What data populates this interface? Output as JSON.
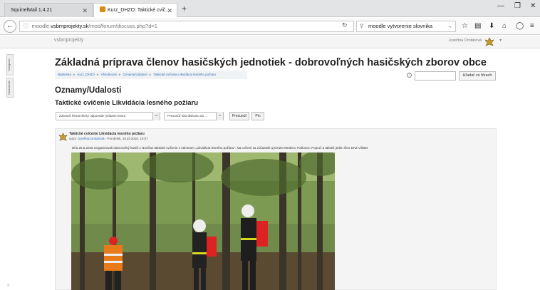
{
  "browser": {
    "tabs": [
      {
        "title": "SquirrelMail 1.4.21"
      },
      {
        "title": "Kurz_DHZO: Taktické cvič..."
      }
    ],
    "url_gray": "moodle.",
    "url_bold": "vsbmprojekty.sk",
    "url_rest": "/mod/forum/discuss.php?d=1",
    "search_value": "moodle vytvorenie slovnika"
  },
  "header": {
    "site_name": "vsbmprojekty",
    "user_name": "Jozefína Drotárová"
  },
  "blocks": {
    "navigation": "Navigácia",
    "admin": "Nastavenie"
  },
  "page": {
    "title": "Základná príprava členov hasičských jednotiek - dobrovoľných hasičských zborov obce",
    "breadcrumb": [
      "Nástenka",
      "Kurz_DHZO",
      "Všeobecné",
      "Oznamy/Udalosti",
      "Taktické cvičenie Likvidácia lesného požiaru"
    ],
    "forum_search_button": "Hľadať vo fórach",
    "forum_name": "Oznamy/Udalosti",
    "discussion_title": "Taktické cvičenie Likvidácia lesného požiaru",
    "display_mode": "Zobraziť hierarchicky odpovede (vrátane textu)",
    "move_discussion": "Presunúť túto diskusiu do ...",
    "move_button": "Presunúť",
    "pin_button": "Pin"
  },
  "post": {
    "subject": "Taktické cvičenie Likvidácia lesného požiaru",
    "author_prefix": "autor",
    "author": "Jozefína Drotárová",
    "date": " - Pondelok, 18 júl 2016, 10:57",
    "body": "Dňa 25.6.2016 zorganizovali dobrovoľný hasiči z Novčian taktické cvičenie s námetom „Likvidácia lesného požiaru\". Na cvičení sa zúčastnili aj DHZO Medzev, Paňovce, Poproč a taktiež jeden člen DHZ VŠBM."
  }
}
